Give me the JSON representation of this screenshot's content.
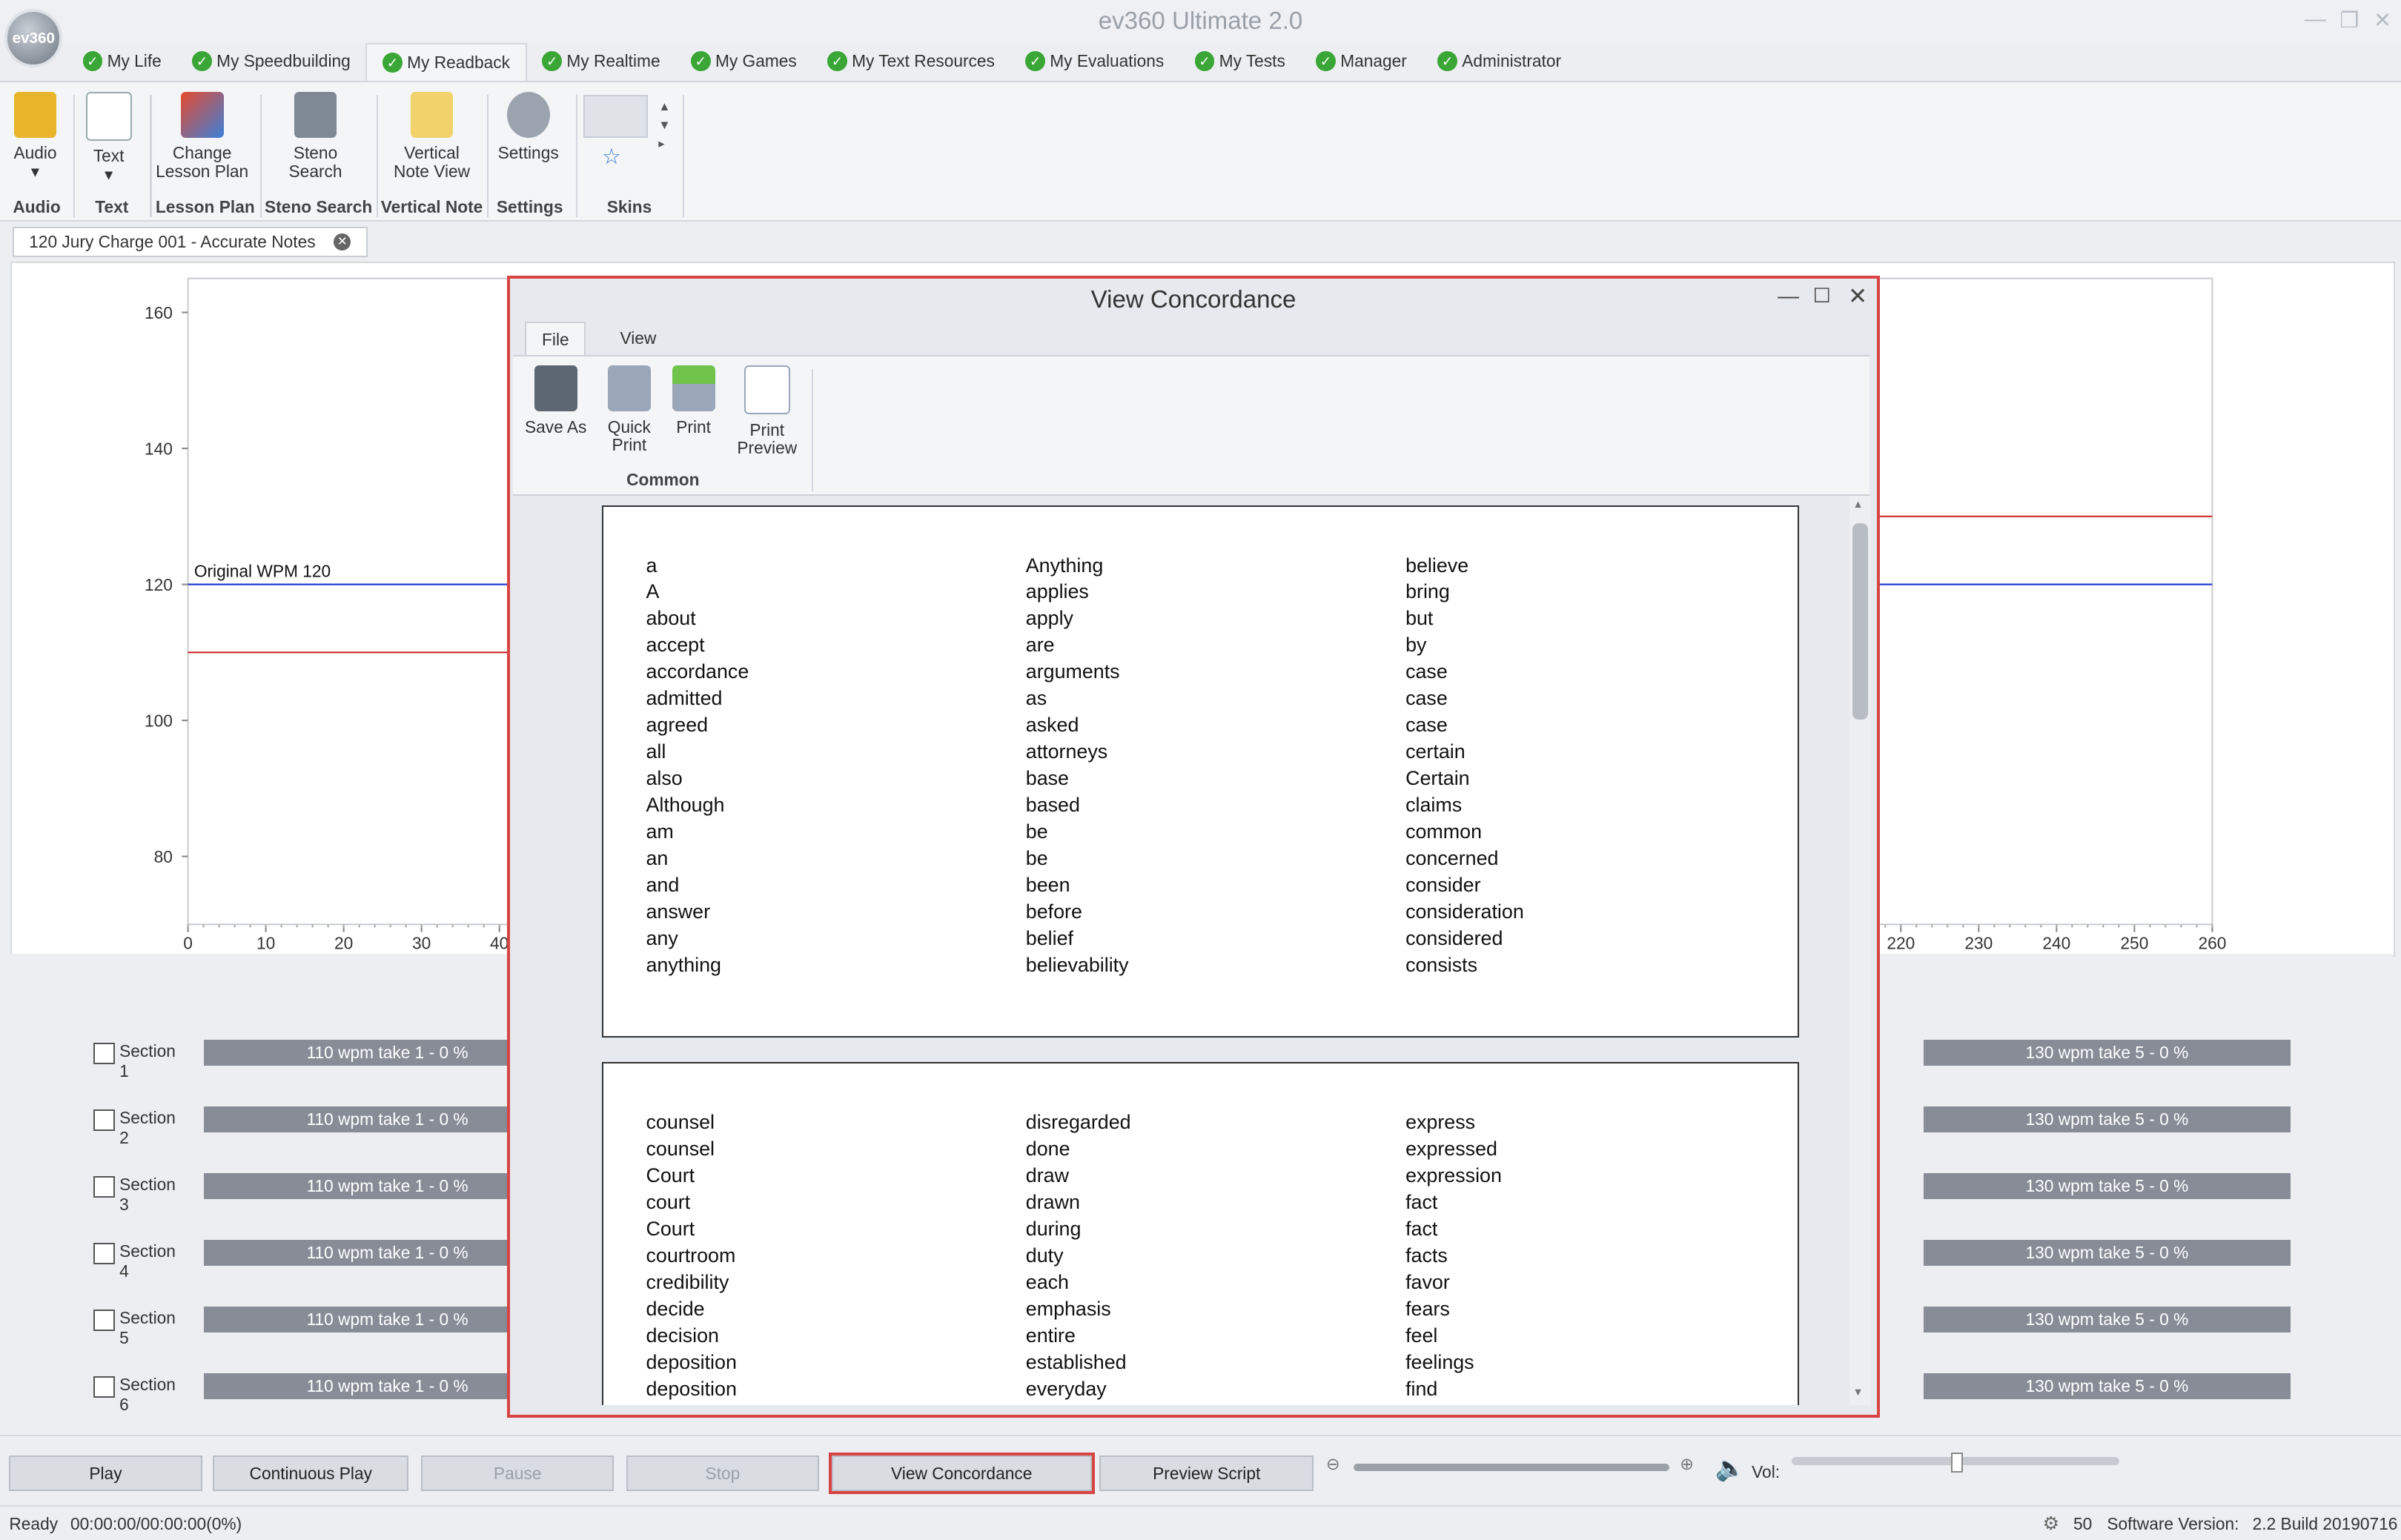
{
  "app": {
    "title": "ev360 Ultimate 2.0",
    "logo_text": "ev360"
  },
  "menu_tabs": [
    {
      "label": "My Life"
    },
    {
      "label": "My Speedbuilding"
    },
    {
      "label": "My Readback"
    },
    {
      "label": "My Realtime"
    },
    {
      "label": "My Games"
    },
    {
      "label": "My Text Resources"
    },
    {
      "label": "My Evaluations"
    },
    {
      "label": "My Tests"
    },
    {
      "label": "Manager"
    },
    {
      "label": "Administrator"
    }
  ],
  "ribbon": {
    "audio": "Audio",
    "text": "Text",
    "change_lesson_plan": "Change Lesson Plan",
    "steno_search": "Steno Search",
    "vertical_note_view": "Vertical Note View",
    "settings": "Settings",
    "groups": {
      "audio": "Audio",
      "text": "Text",
      "lesson_plan": "Lesson Plan",
      "steno_search": "Steno Search",
      "vertical_note": "Vertical Note",
      "settings": "Settings",
      "skins": "Skins"
    }
  },
  "document_tab": "120 Jury Charge 001 - Accurate Notes",
  "chart_data": {
    "type": "line",
    "ylim": [
      70,
      165
    ],
    "xlim": [
      0,
      260
    ],
    "y_ticks": [
      80,
      100,
      120,
      140,
      160
    ],
    "x_ticks": [
      0,
      10,
      20,
      30,
      40,
      220,
      230,
      240,
      250,
      260
    ],
    "annotation": "Original WPM 120",
    "series": [
      {
        "name": "Original WPM 120",
        "color": "#1c2fd1",
        "values": [
          120,
          120
        ]
      },
      {
        "color": "#d42a2a",
        "values": [
          110,
          130
        ]
      }
    ]
  },
  "sections": [
    {
      "label": "Section 1",
      "left_bar": "110 wpm take 1 - 0 %",
      "right_bar": "130 wpm take 5 - 0 %"
    },
    {
      "label": "Section 2",
      "left_bar": "110 wpm take 1 - 0 %",
      "right_bar": "130 wpm take 5 - 0 %"
    },
    {
      "label": "Section 3",
      "left_bar": "110 wpm take 1 - 0 %",
      "right_bar": "130 wpm take 5 - 0 %"
    },
    {
      "label": "Section 4",
      "left_bar": "110 wpm take 1 - 0 %",
      "right_bar": "130 wpm take 5 - 0 %"
    },
    {
      "label": "Section 5",
      "left_bar": "110 wpm take 1 - 0 %",
      "right_bar": "130 wpm take 5 - 0 %"
    },
    {
      "label": "Section 6",
      "left_bar": "110 wpm take 1 - 0 %",
      "right_bar": "130 wpm take 5 - 0 %"
    }
  ],
  "controls": {
    "play": "Play",
    "continuous_play": "Continuous Play",
    "pause": "Pause",
    "stop": "Stop",
    "view_concordance": "View Concordance",
    "preview_script": "Preview  Script",
    "vol": "Vol:"
  },
  "status": {
    "ready": "Ready",
    "time": "00:00:00/00:00:00(0%)",
    "count": "50",
    "version_label": "Software Version:",
    "version": "2.2 Build 20190716"
  },
  "dialog": {
    "title": "View Concordance",
    "tabs": [
      "File",
      "View"
    ],
    "buttons": {
      "save_as": "Save As",
      "quick_print": "Quick Print",
      "print": "Print",
      "print_preview": "Print Preview"
    },
    "group": "Common",
    "page1": {
      "col1": [
        "a",
        "A",
        "about",
        "accept",
        "accordance",
        "admitted",
        "agreed",
        "all",
        "also",
        "Although",
        "am",
        "an",
        "and",
        "answer",
        "any",
        "anything"
      ],
      "col2": [
        "Anything",
        "applies",
        "apply",
        "are",
        "arguments",
        "as",
        "asked",
        "attorneys",
        "base",
        "based",
        "be",
        "be",
        "been",
        "before",
        "belief",
        "believability"
      ],
      "col3": [
        "believe",
        "bring",
        "but",
        "by",
        "case",
        "case",
        "case",
        "certain",
        "Certain",
        "claims",
        "common",
        "concerned",
        "consider",
        "consideration",
        "considered",
        "consists"
      ]
    },
    "page2": {
      "col1": [
        "counsel",
        "counsel",
        "Court",
        "court",
        "Court",
        "courtroom",
        "credibility",
        "decide",
        "decision",
        "deposition",
        "deposition"
      ],
      "col2": [
        "disregarded",
        "done",
        "draw",
        "drawn",
        "during",
        "duty",
        "each",
        "emphasis",
        "entire",
        "established",
        "everyday"
      ],
      "col3": [
        "express",
        "expressed",
        "expression",
        "fact",
        "fact",
        "facts",
        "favor",
        "fears",
        "feel",
        "feelings",
        "find"
      ]
    }
  }
}
